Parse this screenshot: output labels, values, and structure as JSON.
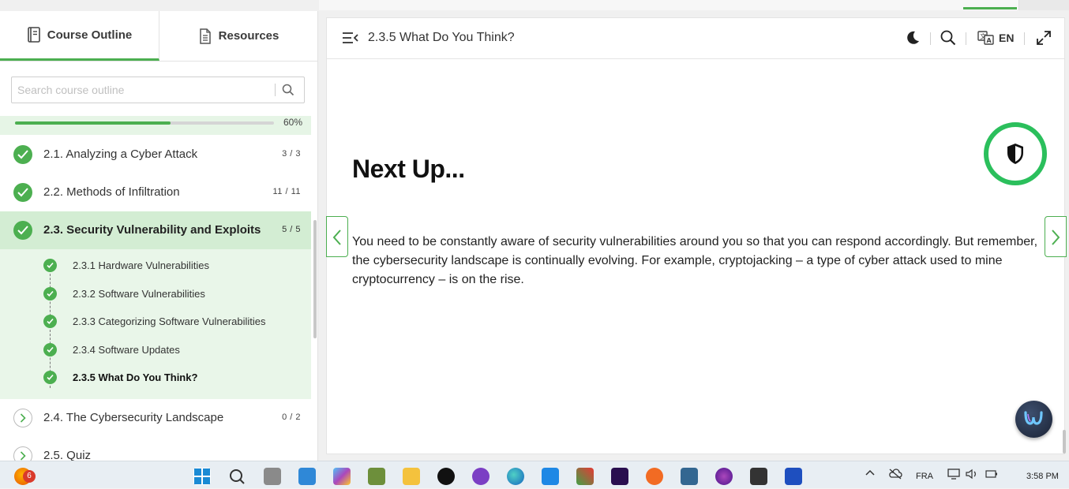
{
  "sidebar": {
    "tabs": [
      {
        "label": "Course Outline",
        "icon": "book-icon",
        "active": true
      },
      {
        "label": "Resources",
        "icon": "document-icon",
        "active": false
      }
    ],
    "search": {
      "placeholder": "Search course outline",
      "value": ""
    },
    "progress": {
      "percent_label": "60%",
      "fraction": 0.6
    },
    "modules": [
      {
        "label": "2.1. Analyzing a Cyber Attack",
        "count": "3 / 3",
        "status": "complete"
      },
      {
        "label": "2.2. Methods of Infiltration",
        "count": "11 / 11",
        "status": "complete"
      },
      {
        "label": "2.3. Security Vulnerability and Exploits",
        "count": "5 / 5",
        "status": "complete-active"
      },
      {
        "label": "2.4. The Cybersecurity Landscape",
        "count": "0 / 2",
        "status": "open"
      },
      {
        "label": "2.5. Quiz",
        "count": "",
        "status": "open"
      }
    ],
    "subitems": [
      {
        "label": "2.3.1 Hardware Vulnerabilities"
      },
      {
        "label": "2.3.2 Software Vulnerabilities"
      },
      {
        "label": "2.3.3 Categorizing Software Vulnerabilities"
      },
      {
        "label": "2.3.4 Software Updates"
      },
      {
        "label": "2.3.5 What Do You Think?"
      }
    ]
  },
  "main": {
    "page_title": "2.3.5 What Do You Think?",
    "language": "EN",
    "heading": "Next Up...",
    "body": "You need to be constantly aware of security vulnerabilities around you so that you can respond accordingly. But remember, the cybersecurity landscape is continually evolving. For example, cryptojacking – a type of cyber attack used to mine cryptocurrency – is on the rise.",
    "badge_icon": "shield-icon"
  },
  "colors": {
    "accent": "#4caf50",
    "badge_ring": "#2bbf5c",
    "active_row": "#d3edd3",
    "sub_area": "#e9f6e9"
  },
  "taskbar": {
    "notification_count": "6",
    "language": "FRA",
    "time": "3:58 PM"
  }
}
